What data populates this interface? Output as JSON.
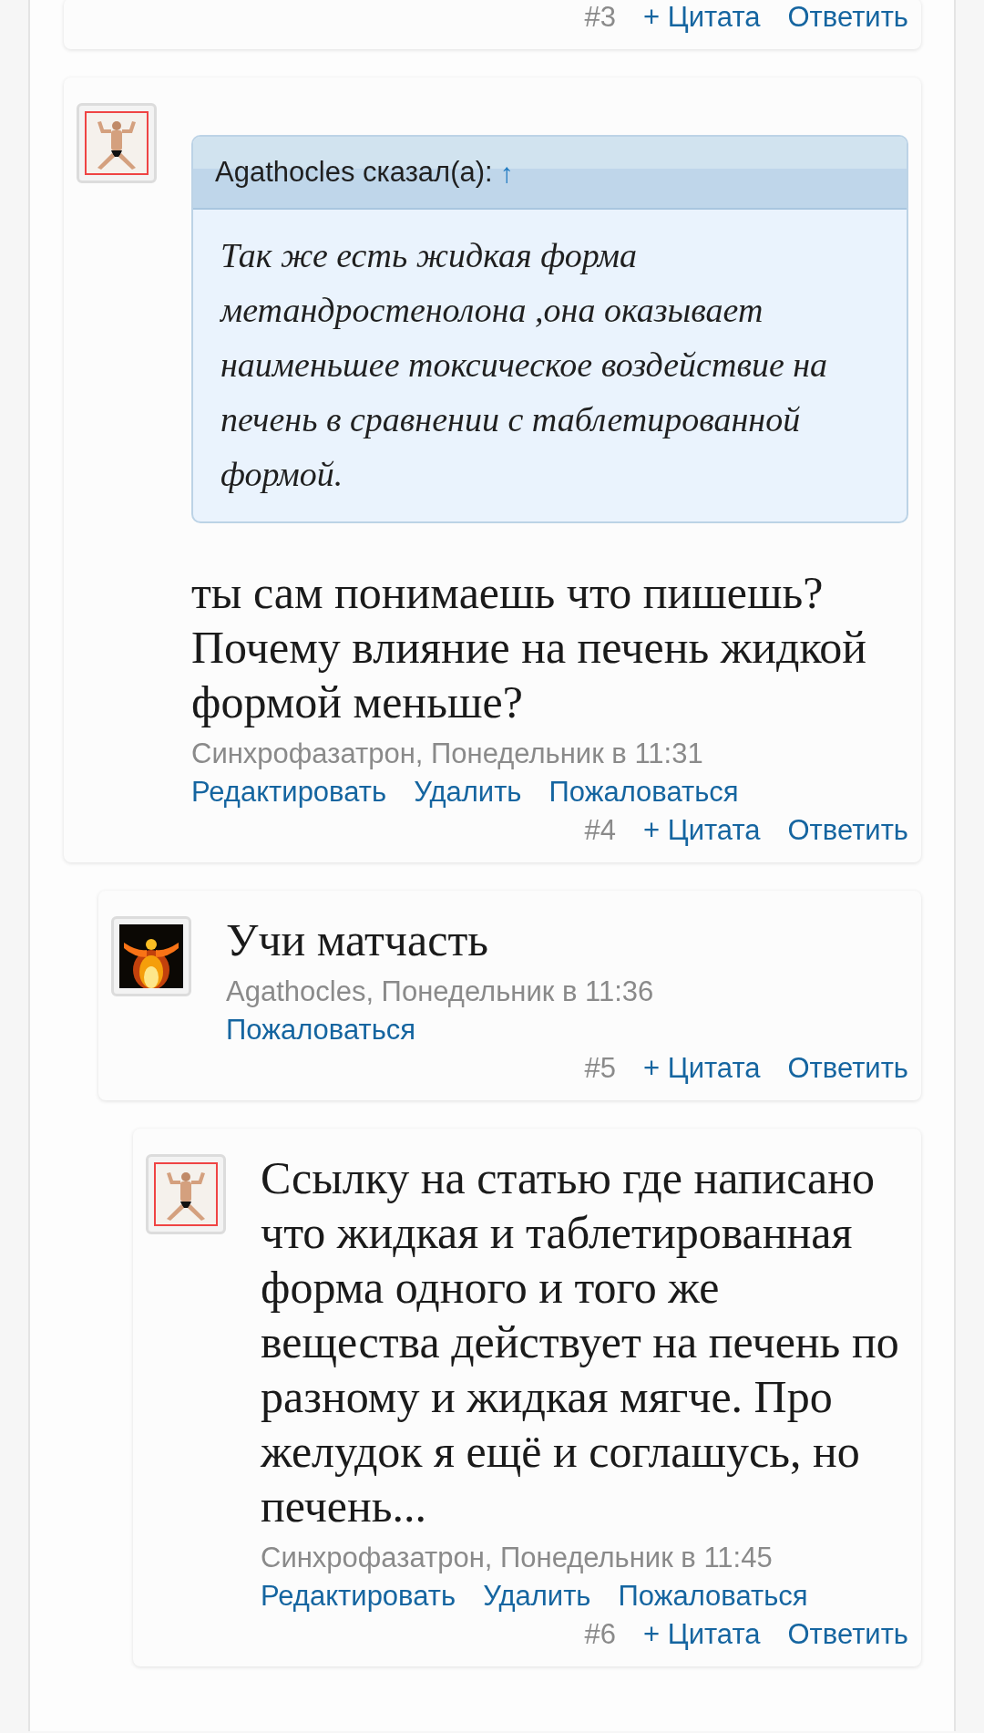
{
  "posts": [
    {
      "number": "#3",
      "quote_link": "+ Цитата",
      "reply_link": "Ответить"
    },
    {
      "avatar": {
        "kind": "picture"
      },
      "quote": {
        "author_line": "Agathocles сказал(а):",
        "jump": "↑",
        "text": "Так же есть жидкая форма метандростенолона ,она оказывает наименьшее токсическое воздействие на печень в сравнении с таблетированной формой."
      },
      "text": "ты сам понимаешь что пишешь? Почему влияние на печень жидкой формой меньше?",
      "meta": "Синхрофазатрон, Понедельник в 11:31",
      "actions": [
        "Редактировать",
        "Удалить",
        "Пожаловаться"
      ],
      "number": "#4",
      "quote_link": "+ Цитата",
      "reply_link": "Ответить",
      "children": [
        {
          "avatar": {
            "kind": "picture"
          },
          "text": "Учи матчасть",
          "meta": "Agathocles, Понедельник в 11:36",
          "actions": [
            "Пожаловаться"
          ],
          "number": "#5",
          "quote_link": "+ Цитата",
          "reply_link": "Ответить",
          "children": [
            {
              "avatar": {
                "kind": "picture"
              },
              "text": "Ссылку на статью где написано что жидкая и таблетированная форма одного и того же вещества действует на печень по разному и жидкая мягче. Про желудок я ещё и соглашусь, но печень...",
              "meta": "Синхрофазатрон, Понедельник в 11:45",
              "actions": [
                "Редактировать",
                "Удалить",
                "Пожаловаться"
              ],
              "number": "#6",
              "quote_link": "+ Цитата",
              "reply_link": "Ответить"
            }
          ]
        }
      ]
    }
  ]
}
